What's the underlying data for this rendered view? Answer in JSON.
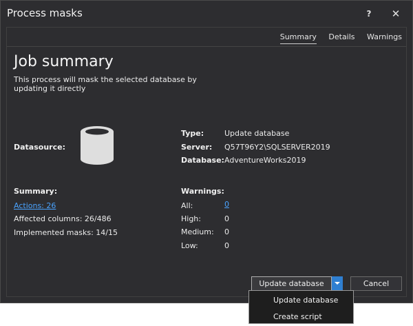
{
  "window": {
    "title": "Process masks",
    "help_label": "?",
    "close_label": "✕"
  },
  "tabs": [
    "Summary",
    "Details",
    "Warnings"
  ],
  "heading": "Job summary",
  "description": "This process will mask the selected database by updating it directly",
  "datasource": {
    "label": "Datasource:",
    "type_label": "Type:",
    "type_value": "Update database",
    "server_label": "Server:",
    "server_value": "Q57T96Y2\\SQLSERVER2019",
    "database_label": "Database:",
    "database_value": "AdventureWorks2019"
  },
  "summary": {
    "label": "Summary:",
    "actions_link": "Actions: 26",
    "affected_columns": "Affected columns: 26/486",
    "implemented_masks": "Implemented masks: 14/15"
  },
  "warnings": {
    "label": "Warnings:",
    "all_label": "All:",
    "all_value": "0",
    "high_label": "High:",
    "high_value": "0",
    "medium_label": "Medium:",
    "medium_value": "0",
    "low_label": "Low:",
    "low_value": "0"
  },
  "buttons": {
    "update": "Update database",
    "cancel": "Cancel"
  },
  "dropdown_menu": [
    "Update database",
    "Create script"
  ],
  "colors": {
    "background": "#2d2d30",
    "link": "#4aa3ff",
    "accent": "#2f7fd1"
  }
}
